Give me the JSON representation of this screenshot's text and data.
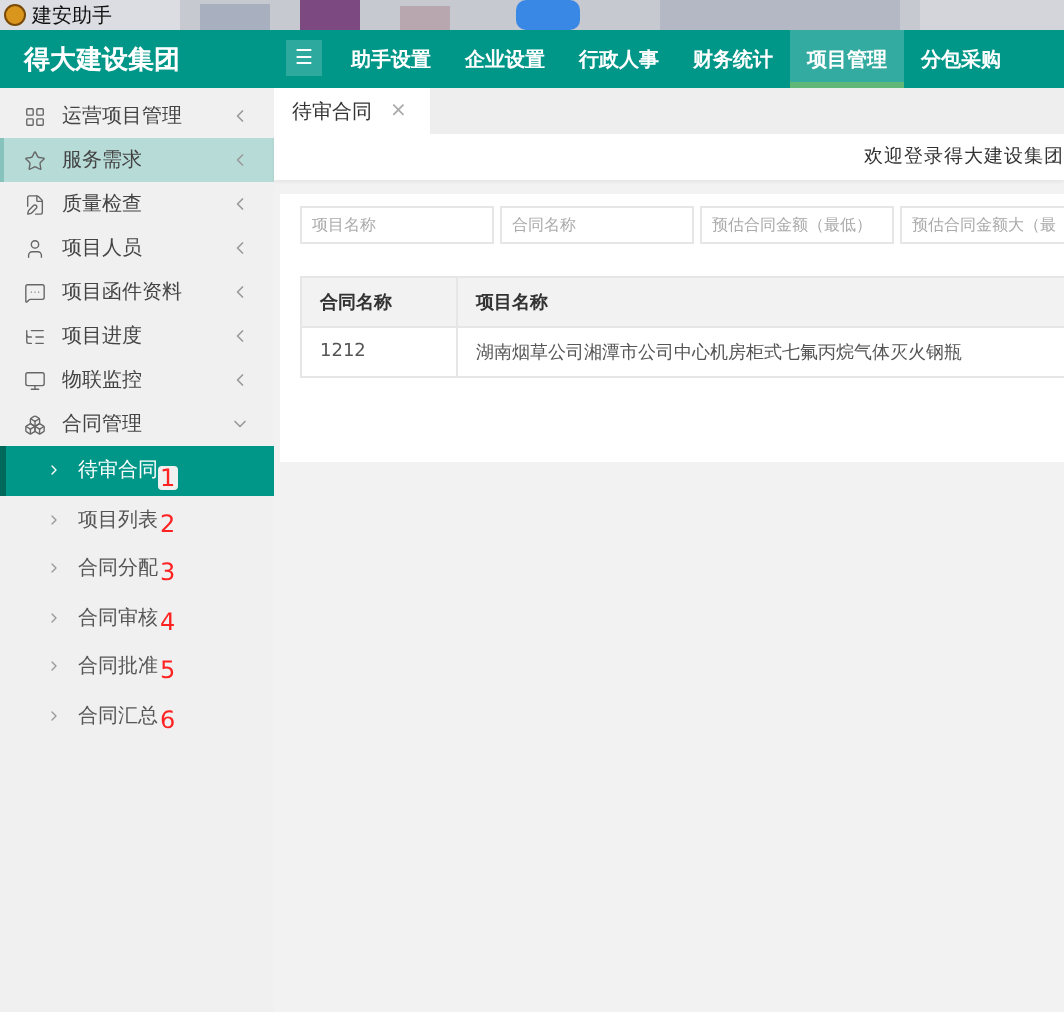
{
  "window": {
    "title": "建安助手"
  },
  "header": {
    "brand": "得大建设集团",
    "menu_icon": "☰",
    "nav": [
      {
        "label": "助手设置",
        "selected": false
      },
      {
        "label": "企业设置",
        "selected": false
      },
      {
        "label": "行政人事",
        "selected": false
      },
      {
        "label": "财务统计",
        "selected": false
      },
      {
        "label": "项目管理",
        "selected": true
      },
      {
        "label": "分包采购",
        "selected": false
      }
    ]
  },
  "sidebar": {
    "items": [
      {
        "label": "运营项目管理",
        "expanded": false,
        "selected": false
      },
      {
        "label": "服务需求",
        "expanded": false,
        "selected": true
      },
      {
        "label": "质量检查",
        "expanded": false,
        "selected": false
      },
      {
        "label": "项目人员",
        "expanded": false,
        "selected": false
      },
      {
        "label": "项目函件资料",
        "expanded": false,
        "selected": false
      },
      {
        "label": "项目进度",
        "expanded": false,
        "selected": false
      },
      {
        "label": "物联监控",
        "expanded": false,
        "selected": false
      },
      {
        "label": "合同管理",
        "expanded": true,
        "selected": false,
        "children": [
          {
            "label": "待审合同",
            "selected": true,
            "mark": "1"
          },
          {
            "label": "项目列表",
            "selected": false,
            "mark": "2"
          },
          {
            "label": "合同分配",
            "selected": false,
            "mark": "3"
          },
          {
            "label": "合同审核",
            "selected": false,
            "mark": "4"
          },
          {
            "label": "合同批准",
            "selected": false,
            "mark": "5"
          },
          {
            "label": "合同汇总",
            "selected": false,
            "mark": "6"
          }
        ]
      }
    ]
  },
  "tabs": [
    {
      "label": "待审合同",
      "close": "×",
      "selected": true
    }
  ],
  "welcome": "欢迎登录得大建设集团",
  "filters": [
    {
      "placeholder": "项目名称"
    },
    {
      "placeholder": "合同名称"
    },
    {
      "placeholder": "预估合同金额（最低）"
    },
    {
      "placeholder": "预估合同金额大（最"
    }
  ],
  "table": {
    "columns": [
      "合同名称",
      "项目名称"
    ],
    "rows": [
      [
        "1212",
        "湖南烟草公司湘潭市公司中心机房柜式七氟丙烷气体灭火钢瓶"
      ]
    ]
  }
}
